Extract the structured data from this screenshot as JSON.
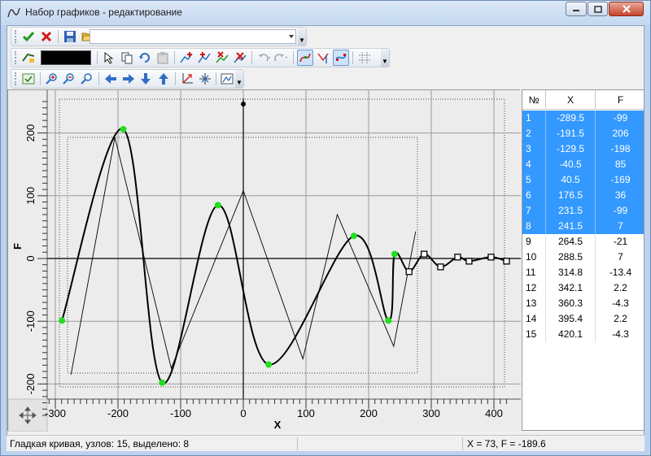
{
  "window": {
    "title": "Набор графиков - редактирование",
    "buttons": [
      "minimize",
      "maximize",
      "close"
    ]
  },
  "toolbar1": {
    "icons": [
      "ok-check-icon",
      "cancel-x-icon",
      "save-disk-icon",
      "open-folder-icon"
    ],
    "combo_value": ""
  },
  "toolbar2": {
    "icons": [
      "line-color-icon",
      "select-arrow-icon",
      "copy-icon",
      "refresh-icon",
      "paste-icon",
      "add-node-icon",
      "insert-node-icon",
      "delete-node-icon",
      "delete-all-icon",
      "undo-icon",
      "redo-icon",
      "smooth-curve-icon",
      "vertical-line-icon",
      "node-select-icon",
      "grid-lines-icon"
    ],
    "color_swatch": "#000000"
  },
  "toolbar3": {
    "icons": [
      "fit-view-icon",
      "zoom-in-icon",
      "zoom-out-icon",
      "zoom-reset-icon",
      "arrow-left-icon",
      "arrow-right-icon",
      "arrow-down-icon",
      "arrow-up-icon",
      "scale-xy-icon",
      "scale-icon",
      "export-image-icon"
    ]
  },
  "chart_data": {
    "type": "line",
    "xlabel": "X",
    "ylabel": "F",
    "xlim": [
      -315,
      420
    ],
    "ylim": [
      -250,
      255
    ],
    "x_ticks": [
      -300,
      -200,
      -100,
      0,
      100,
      200,
      300,
      400
    ],
    "y_ticks": [
      -200,
      -100,
      0,
      100,
      200
    ],
    "grid": true,
    "series": [
      {
        "style": "smooth curve",
        "points": [
          [
            -289.5,
            -99
          ],
          [
            -191.5,
            206
          ],
          [
            -129.5,
            -198
          ],
          [
            -40.5,
            85
          ],
          [
            40.5,
            -169
          ],
          [
            176.5,
            36
          ],
          [
            231.5,
            -99
          ],
          [
            241.5,
            7
          ],
          [
            264.5,
            -21
          ],
          [
            288.5,
            7
          ],
          [
            314.8,
            -13.4
          ],
          [
            342.1,
            2.2
          ],
          [
            360.3,
            -4.3
          ],
          [
            395.4,
            2.2
          ],
          [
            420.1,
            -4.3
          ]
        ],
        "selected_count": 8
      },
      {
        "style": "polyline",
        "points": [
          [
            -275,
            -185
          ],
          [
            -205,
            193
          ],
          [
            -115,
            -175
          ],
          [
            0,
            108
          ],
          [
            95,
            -160
          ],
          [
            150,
            70
          ],
          [
            240,
            -140
          ],
          [
            275,
            43
          ]
        ]
      }
    ]
  },
  "table": {
    "headers": [
      "№",
      "X",
      "F"
    ],
    "rows": [
      {
        "n": "1",
        "x": "-289.5",
        "f": "-99",
        "sel": true
      },
      {
        "n": "2",
        "x": "-191.5",
        "f": "206",
        "sel": true
      },
      {
        "n": "3",
        "x": "-129.5",
        "f": "-198",
        "sel": true
      },
      {
        "n": "4",
        "x": "-40.5",
        "f": "85",
        "sel": true
      },
      {
        "n": "5",
        "x": "40.5",
        "f": "-169",
        "sel": true
      },
      {
        "n": "6",
        "x": "176.5",
        "f": "36",
        "sel": true
      },
      {
        "n": "7",
        "x": "231.5",
        "f": "-99",
        "sel": true
      },
      {
        "n": "8",
        "x": "241.5",
        "f": "7",
        "sel": true
      },
      {
        "n": "9",
        "x": "264.5",
        "f": "-21",
        "sel": false
      },
      {
        "n": "10",
        "x": "288.5",
        "f": "7",
        "sel": false
      },
      {
        "n": "11",
        "x": "314.8",
        "f": "-13.4",
        "sel": false
      },
      {
        "n": "12",
        "x": "342.1",
        "f": "2.2",
        "sel": false
      },
      {
        "n": "13",
        "x": "360.3",
        "f": "-4.3",
        "sel": false
      },
      {
        "n": "14",
        "x": "395.4",
        "f": "2.2",
        "sel": false
      },
      {
        "n": "15",
        "x": "420.1",
        "f": "-4.3",
        "sel": false
      }
    ]
  },
  "status": {
    "left": "Гладкая кривая, узлов: 15, выделено: 8",
    "right": "X = 73, F = -189.6"
  },
  "colors": {
    "selected_node": "#22dd22",
    "selection_row": "#3399ff"
  }
}
